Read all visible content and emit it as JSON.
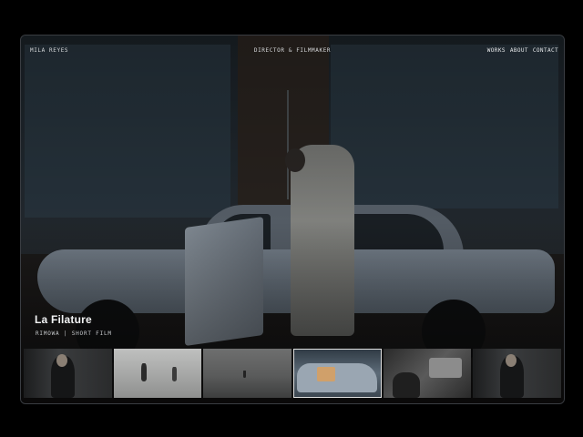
{
  "header": {
    "brand": "MILA REYES",
    "tagline": "DIRECTOR & FILMMAKER",
    "nav": [
      "WORKS",
      "ABOUT",
      "CONTACT"
    ]
  },
  "featured": {
    "title": "La Filature",
    "subtitle": "RIMOWA | SHORT FILM"
  },
  "thumbnails": [
    {
      "name": "thumb-portrait-man-suit"
    },
    {
      "name": "thumb-figures-on-beach"
    },
    {
      "name": "thumb-grey-landscape"
    },
    {
      "name": "thumb-car-driver"
    },
    {
      "name": "thumb-typewriter-desk"
    },
    {
      "name": "thumb-portrait-man-suit-2"
    }
  ],
  "active_thumbnail": 3
}
